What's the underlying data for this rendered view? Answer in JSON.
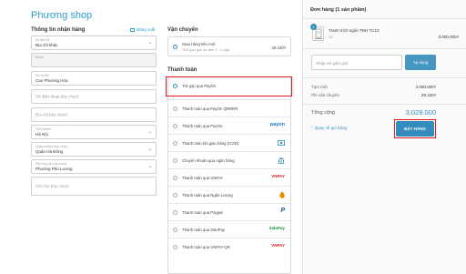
{
  "shop": {
    "name": "Phương shop"
  },
  "shipping_info": {
    "title": "Thông tin nhận hàng",
    "logout_label": "Đăng xuất",
    "account_label": "Số địa chỉ",
    "account_value": "Địa chỉ khác",
    "email_label": "Email",
    "name_label": "Họ và tên",
    "name_value": "Cao Phương Hòa",
    "phone_placeholder": "Số điện thoại (tùy chọn)",
    "address_placeholder": "Địa chỉ (tùy chọn)",
    "province_label": "Tỉnh thành",
    "province_value": "Hà Nội",
    "district_label": "Quận huyện (tùy chọn)",
    "district_value": "Quận Hà Đông",
    "ward_label": "Phường xã (tùy chọn)",
    "ward_value": "Phường Phú Lương",
    "note_placeholder": "Ghi chú (tùy chọn)"
  },
  "shipping_method": {
    "title": "Vận chuyển",
    "option_name": "Giao hàng tiêu mới",
    "option_desc": "Thời gian giao dự kiến: 1 - 2 ngày",
    "option_price": "28.100₫"
  },
  "payment": {
    "title": "Thanh toán",
    "methods": [
      {
        "label": "Trả góp qua PayOn",
        "logo": "",
        "logo_color": "#000000"
      },
      {
        "label": "Thanh toán qua PayOn QRRRR",
        "logo": "",
        "logo_color": "#000000"
      },
      {
        "label": "Thanh toán qua PayOn",
        "logo": "payon",
        "logo_color": "#1e73be"
      },
      {
        "label": "Thanh toán khi giao hàng (COD)",
        "logo": "",
        "logo_color": "#338dbc"
      },
      {
        "label": "Chuyển khoản qua ngân hàng",
        "logo": "",
        "logo_color": "#338dbc"
      },
      {
        "label": "Thanh toán qua VNPAY",
        "logo": "VNPAY",
        "logo_color": "#d8231f"
      },
      {
        "label": "Thanh toán qua Ngân Lượng",
        "logo": "",
        "logo_color": "#e88b00"
      },
      {
        "label": "Thanh toán qua Paypal",
        "logo": "P",
        "logo_color": "#1e4d9c"
      },
      {
        "label": "Thanh toán qua ZaloPay",
        "logo": "ZaloPay",
        "logo_color": "#1b8d3e"
      },
      {
        "label": "Thanh toán qua VNPAY-QR",
        "logo": "VNPAY",
        "logo_color": "#d8231f"
      }
    ]
  },
  "order": {
    "title": "Đơn hàng (1 sản phẩm)",
    "item_qty": "1",
    "item_name": "Tranh trích ngôn TNH TC10",
    "item_variant": "22",
    "item_price": "3.000.000₫",
    "discount_placeholder": "Nhập mã giảm giá",
    "apply_label": "Áp dụng",
    "subtotal_label": "Tạm tính",
    "subtotal_value": "3.000.000₫",
    "shipping_label": "Phí vận chuyển",
    "shipping_value": "28.100₫",
    "total_label": "Tổng cộng",
    "total_value": "3.028.000",
    "back_label": "Quay về giỏ hàng",
    "place_order_label": "ĐẶT HÀNG"
  },
  "colors": {
    "accent": "#338dbc",
    "highlight": "#e0161b"
  }
}
